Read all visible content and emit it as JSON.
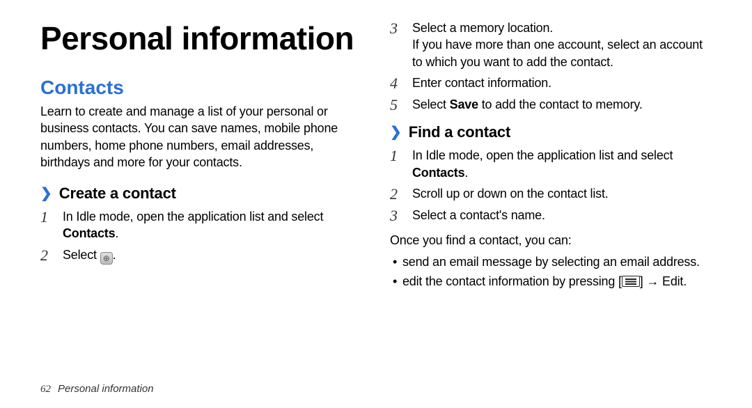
{
  "title": "Personal information",
  "footer": {
    "page": "62",
    "label": "Personal information"
  },
  "left": {
    "section": "Contacts",
    "intro": "Learn to create and manage a list of your personal or business contacts. You can save names, mobile phone numbers, home phone numbers, email addresses, birthdays and more for your contacts.",
    "sub_create": "Create a contact",
    "create_steps": {
      "s1_a": "In Idle mode, open the application list and select ",
      "s1_b": "Contacts",
      "s1_c": ".",
      "s2_a": "Select ",
      "s2_b": "."
    }
  },
  "right": {
    "cont_steps": {
      "s3_line1": "Select a memory location.",
      "s3_line2": "If you have more than one account, select an account to which you want to add the contact.",
      "s4": "Enter contact information.",
      "s5_a": "Select ",
      "s5_b": "Save",
      "s5_c": " to add the contact to memory."
    },
    "sub_find": "Find a contact",
    "find_steps": {
      "s1_a": "In Idle mode, open the application list and select ",
      "s1_b": "Contacts",
      "s1_c": ".",
      "s2": "Scroll up or down on the contact list.",
      "s3": "Select a contact's name."
    },
    "after": "Once you find a contact, you can:",
    "bullets": {
      "b1": "send an email message by selecting an email address.",
      "b2_a": "edit the contact information by pressing [",
      "b2_b": "] ",
      "b2_arrow": "→",
      "b2_c": " ",
      "b2_d": "Edit",
      "b2_e": "."
    }
  },
  "nums": {
    "n1": "1",
    "n2": "2",
    "n3": "3",
    "n4": "4",
    "n5": "5"
  }
}
